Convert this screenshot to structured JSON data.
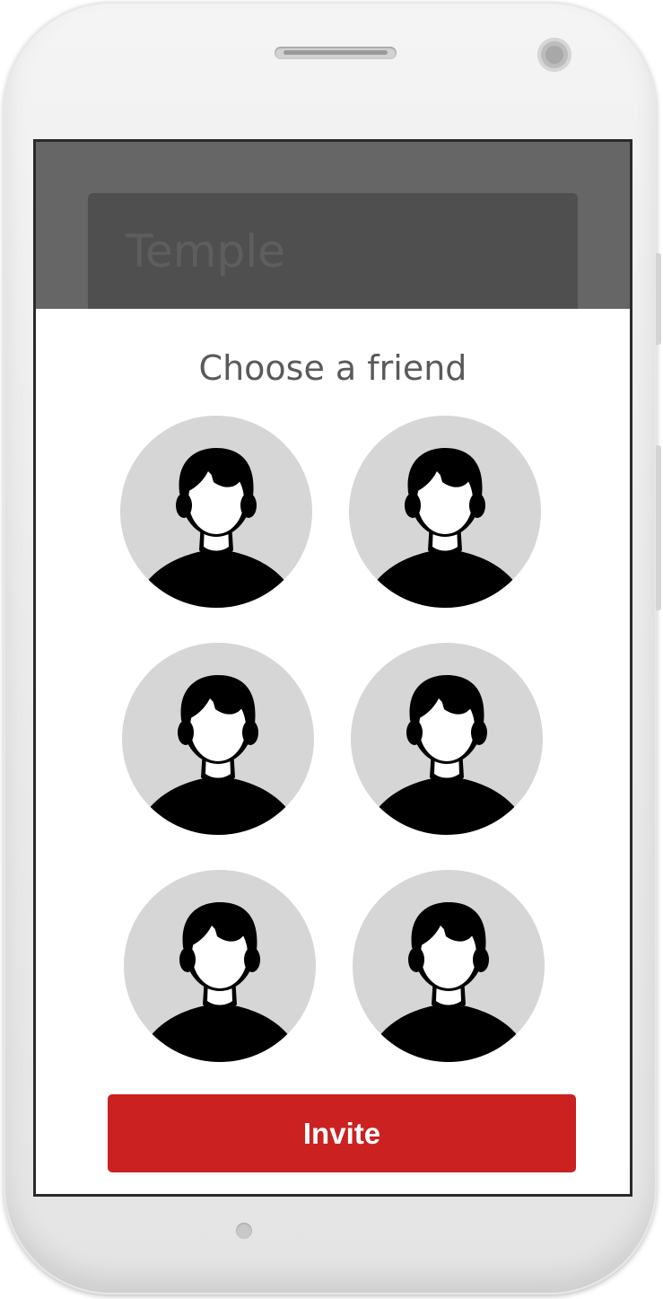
{
  "background_app": {
    "field_text": "Temple"
  },
  "dialog": {
    "title": "Choose a friend",
    "friends": [
      {
        "icon": "person-avatar-icon"
      },
      {
        "icon": "person-avatar-icon"
      },
      {
        "icon": "person-avatar-icon"
      },
      {
        "icon": "person-avatar-icon"
      },
      {
        "icon": "person-avatar-icon"
      },
      {
        "icon": "person-avatar-icon"
      }
    ],
    "invite_label": "Invite"
  },
  "colors": {
    "accent": "#cb2121",
    "overlay": "#666666",
    "avatar_bg": "#d6d6d6"
  }
}
